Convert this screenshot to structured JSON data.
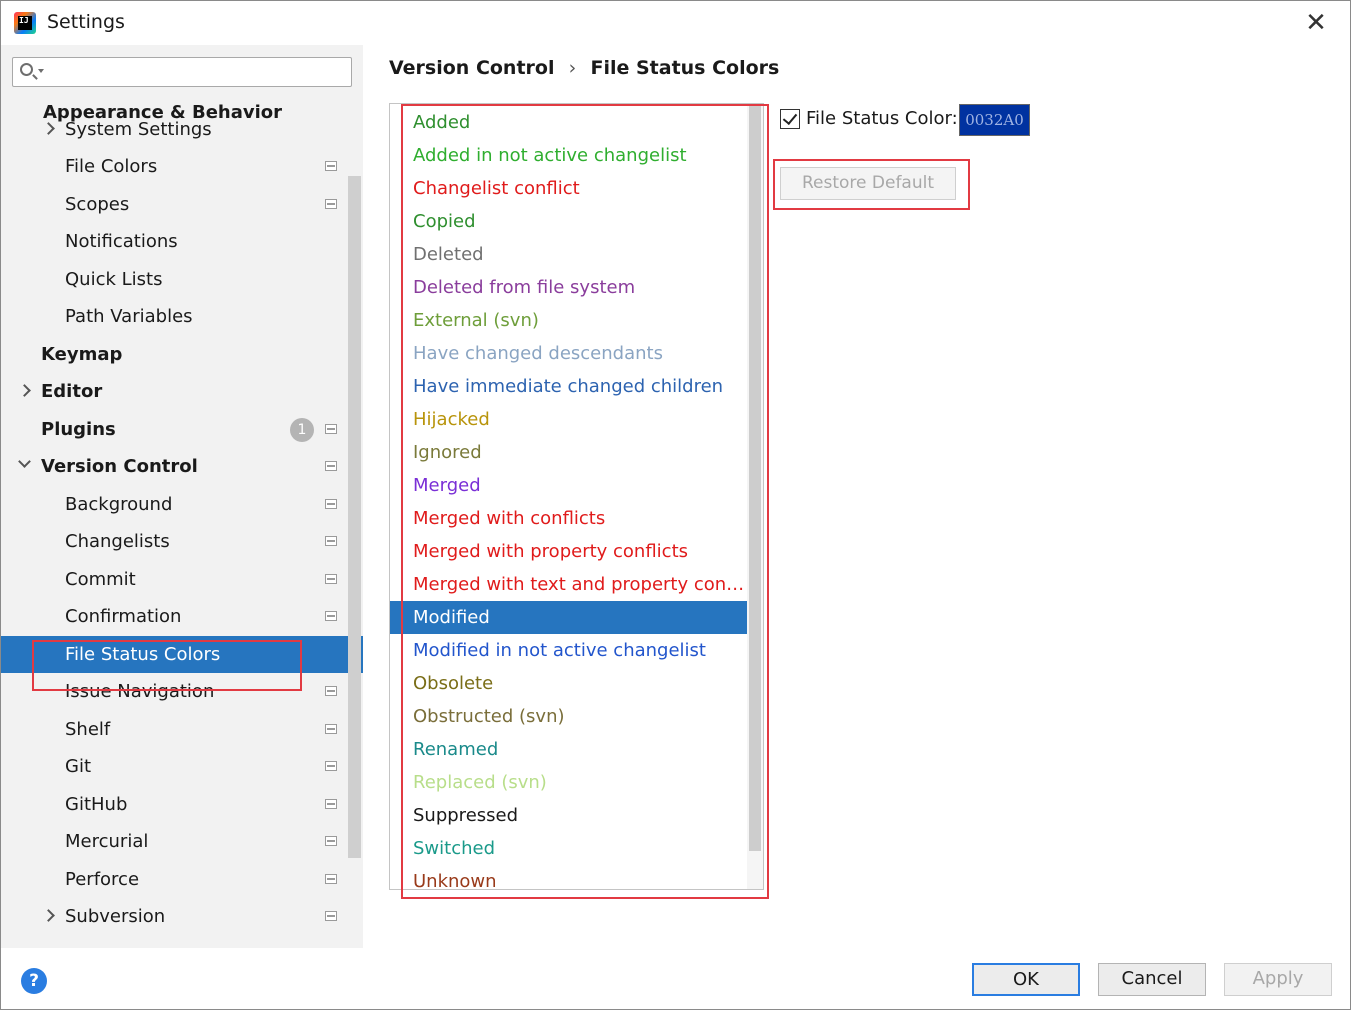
{
  "window": {
    "title": "Settings",
    "close_label": "✕",
    "app_icon_text": "IJ"
  },
  "search": {
    "value": "",
    "placeholder": ""
  },
  "sidebar": {
    "items": [
      {
        "label": "Appearance & Behavior",
        "level": 0,
        "bold": true,
        "expander": "none",
        "y": 0
      },
      {
        "label": "System Settings",
        "level": 1,
        "bold": false,
        "expander": "right",
        "y": 25
      },
      {
        "label": "File Colors",
        "level": 1,
        "bold": false,
        "expander": "none",
        "project": true
      },
      {
        "label": "Scopes",
        "level": 1,
        "bold": false,
        "expander": "none",
        "project": true
      },
      {
        "label": "Notifications",
        "level": 1,
        "bold": false,
        "expander": "none"
      },
      {
        "label": "Quick Lists",
        "level": 1,
        "bold": false,
        "expander": "none"
      },
      {
        "label": "Path Variables",
        "level": 1,
        "bold": false,
        "expander": "none"
      },
      {
        "label": "Keymap",
        "level": 0,
        "bold": true,
        "expander": "none"
      },
      {
        "label": "Editor",
        "level": 0,
        "bold": true,
        "expander": "right"
      },
      {
        "label": "Plugins",
        "level": 0,
        "bold": true,
        "expander": "none",
        "project": true,
        "badge": "1"
      },
      {
        "label": "Version Control",
        "level": 0,
        "bold": true,
        "expander": "down",
        "project": true
      },
      {
        "label": "Background",
        "level": 1,
        "bold": false,
        "expander": "none",
        "project": true
      },
      {
        "label": "Changelists",
        "level": 1,
        "bold": false,
        "expander": "none",
        "project": true
      },
      {
        "label": "Commit",
        "level": 1,
        "bold": false,
        "expander": "none",
        "project": true
      },
      {
        "label": "Confirmation",
        "level": 1,
        "bold": false,
        "expander": "none",
        "project": true
      },
      {
        "label": "File Status Colors",
        "level": 1,
        "bold": false,
        "expander": "none",
        "selected": true
      },
      {
        "label": "Issue Navigation",
        "level": 1,
        "bold": false,
        "expander": "none",
        "project": true
      },
      {
        "label": "Shelf",
        "level": 1,
        "bold": false,
        "expander": "none",
        "project": true
      },
      {
        "label": "Git",
        "level": 1,
        "bold": false,
        "expander": "none",
        "project": true
      },
      {
        "label": "GitHub",
        "level": 1,
        "bold": false,
        "expander": "none",
        "project": true
      },
      {
        "label": "Mercurial",
        "level": 1,
        "bold": false,
        "expander": "none",
        "project": true
      },
      {
        "label": "Perforce",
        "level": 1,
        "bold": false,
        "expander": "none",
        "project": true
      },
      {
        "label": "Subversion",
        "level": 1,
        "bold": false,
        "expander": "right",
        "project": true
      }
    ]
  },
  "breadcrumb": {
    "parent": "Version Control",
    "separator": "›",
    "current": "File Status Colors"
  },
  "status_list": {
    "items": [
      {
        "label": "Added",
        "color": "#2f8f2f"
      },
      {
        "label": "Added in not active changelist",
        "color": "#2fae2f"
      },
      {
        "label": "Changelist conflict",
        "color": "#e01b1b"
      },
      {
        "label": "Copied",
        "color": "#2f8f2f"
      },
      {
        "label": "Deleted",
        "color": "#707070"
      },
      {
        "label": "Deleted from file system",
        "color": "#8a3d9c"
      },
      {
        "label": "External (svn)",
        "color": "#6e9e3a"
      },
      {
        "label": "Have changed descendants",
        "color": "#8aa4c2"
      },
      {
        "label": "Have immediate changed children",
        "color": "#2d63b0"
      },
      {
        "label": "Hijacked",
        "color": "#b8940b"
      },
      {
        "label": "Ignored",
        "color": "#7a7a3a"
      },
      {
        "label": "Merged",
        "color": "#7a2fd6"
      },
      {
        "label": "Merged with conflicts",
        "color": "#e01b1b"
      },
      {
        "label": "Merged with property conflicts",
        "color": "#e01b1b"
      },
      {
        "label": "Merged with text and property confli...",
        "color": "#e01b1b"
      },
      {
        "label": "Modified",
        "color": "#0032a0",
        "selected": true
      },
      {
        "label": "Modified in not active changelist",
        "color": "#2255cc"
      },
      {
        "label": "Obsolete",
        "color": "#7a6e18"
      },
      {
        "label": "Obstructed (svn)",
        "color": "#7a6e3a"
      },
      {
        "label": "Renamed",
        "color": "#1a8a8a"
      },
      {
        "label": "Replaced (svn)",
        "color": "#b8de8a"
      },
      {
        "label": "Suppressed",
        "color": "#1a1a1a"
      },
      {
        "label": "Switched",
        "color": "#1a9a8a"
      },
      {
        "label": "Unknown",
        "color": "#993a1a"
      }
    ]
  },
  "color_option": {
    "label": "File Status Color:",
    "checked": true,
    "value": "0032A0",
    "swatch_color": "#0032a0"
  },
  "restore_button": {
    "label": "Restore Default"
  },
  "footer": {
    "help_label": "?",
    "ok_label": "OK",
    "cancel_label": "Cancel",
    "apply_label": "Apply"
  }
}
